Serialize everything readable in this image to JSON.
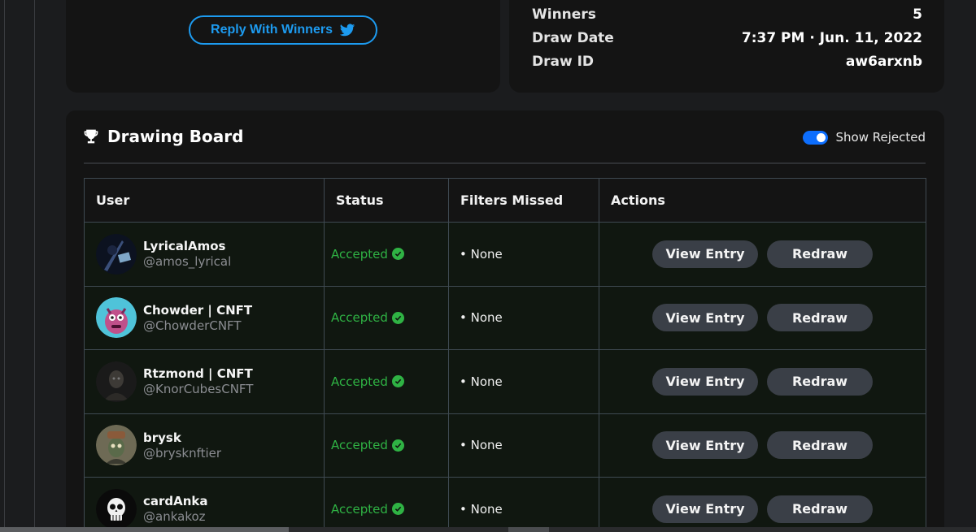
{
  "reply_button": {
    "label": "Reply With Winners",
    "icon": "twitter-icon",
    "color": "#1d9bf0"
  },
  "info": [
    {
      "key": "Winners",
      "value": "5"
    },
    {
      "key": "Draw Date",
      "value": "7:37 PM · Jun. 11, 2022"
    },
    {
      "key": "Draw ID",
      "value": "aw6arxnb"
    }
  ],
  "board": {
    "title": "Drawing Board",
    "title_icon": "trophy-icon",
    "toggle_label": "Show Rejected",
    "toggle_on": true,
    "accent": "#0d6efd"
  },
  "table": {
    "headers": [
      "User",
      "Status",
      "Filters Missed",
      "Actions"
    ],
    "rows": [
      {
        "name": "LyricalAmos",
        "handle": "@amos_lyrical",
        "status": "Accepted",
        "filters": "• None",
        "view": "View Entry",
        "redraw": "Redraw"
      },
      {
        "name": "Chowder | CNFT",
        "handle": "@ChowderCNFT",
        "status": "Accepted",
        "filters": "• None",
        "view": "View Entry",
        "redraw": "Redraw"
      },
      {
        "name": "Rtzmond | CNFT",
        "handle": "@KnorCubesCNFT",
        "status": "Accepted",
        "filters": "• None",
        "view": "View Entry",
        "redraw": "Redraw"
      },
      {
        "name": "brysk",
        "handle": "@brysknftier",
        "status": "Accepted",
        "filters": "• None",
        "view": "View Entry",
        "redraw": "Redraw"
      },
      {
        "name": "cardAnka",
        "handle": "@ankakoz",
        "status": "Accepted",
        "filters": "• None",
        "view": "View Entry",
        "redraw": "Redraw"
      }
    ],
    "status_color": "#2fb344"
  }
}
